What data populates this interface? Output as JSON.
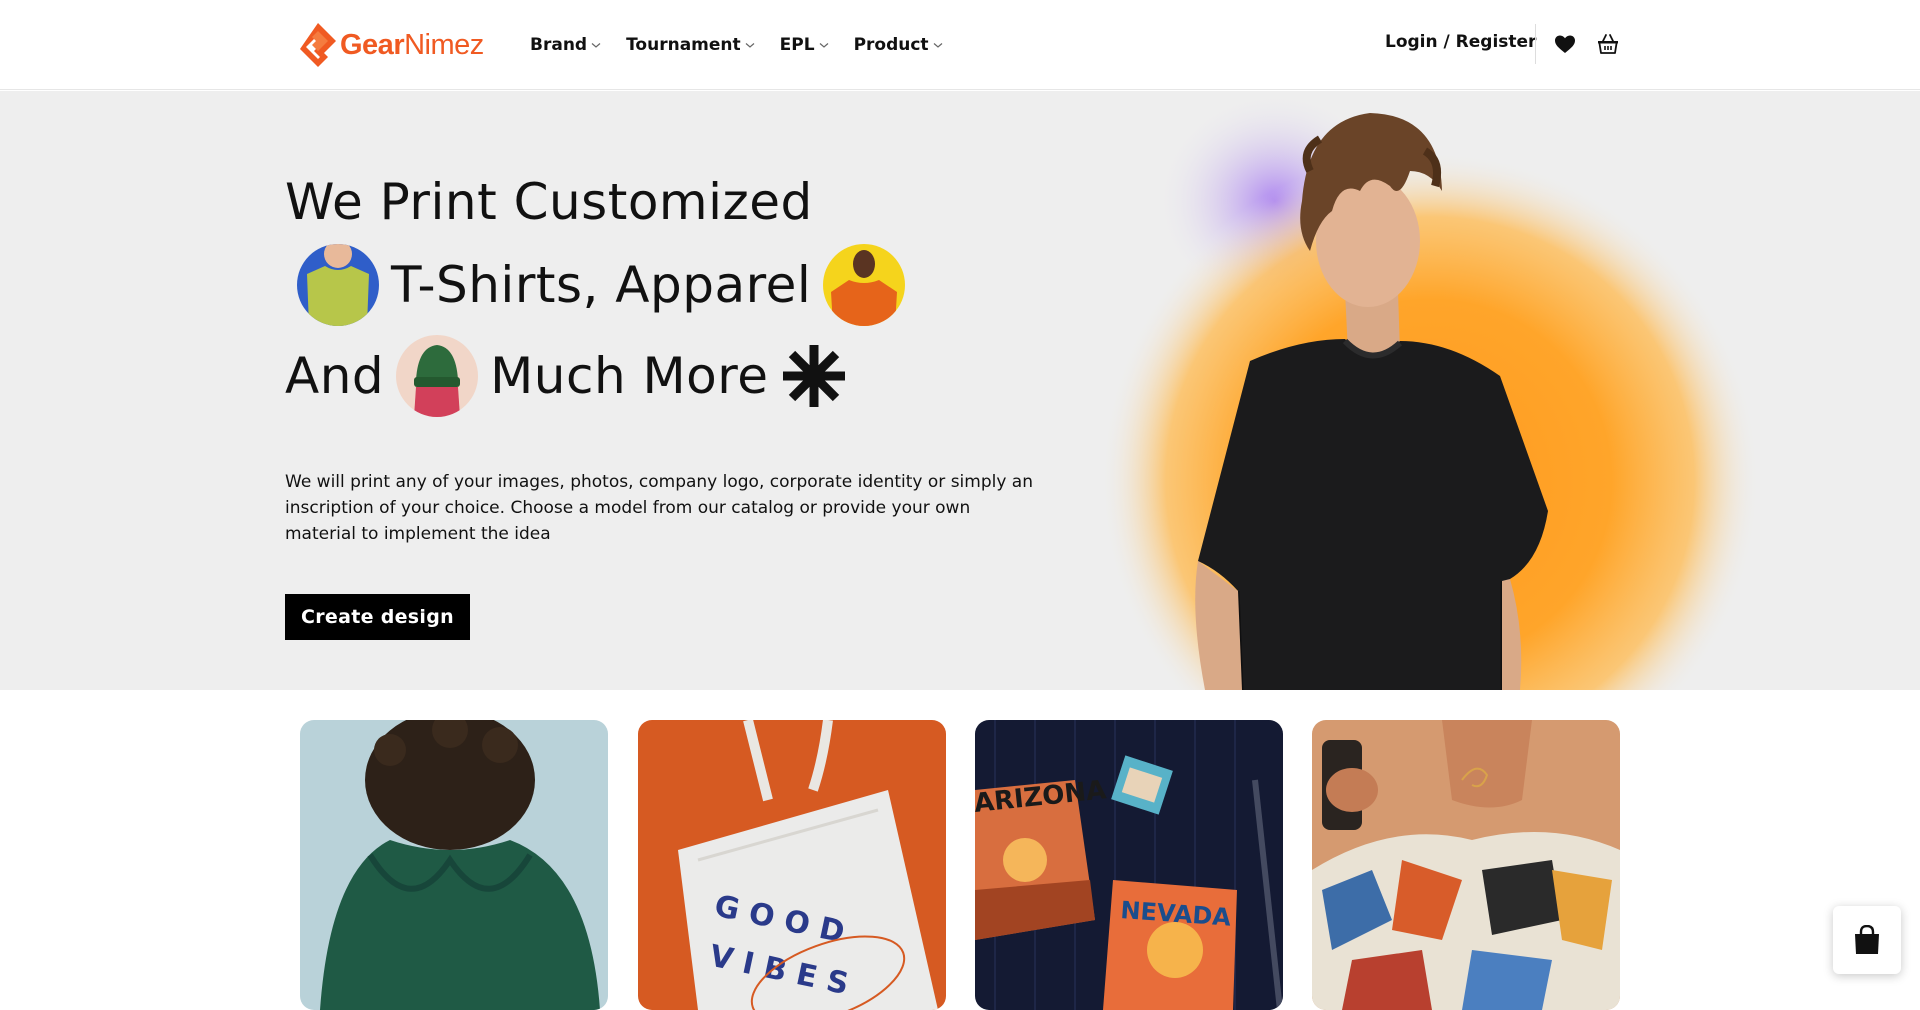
{
  "header": {
    "logo_text_bold": "Gear",
    "logo_text_light": "Nimez",
    "nav": [
      {
        "label": "Brand",
        "icon": "chevron-down-icon"
      },
      {
        "label": "Tournament",
        "icon": "chevron-down-icon"
      },
      {
        "label": "EPL",
        "icon": "chevron-down-icon"
      },
      {
        "label": "Product",
        "icon": "chevron-down-icon"
      }
    ],
    "login_label": "Login / Register",
    "wishlist_icon": "heart-icon",
    "cart_icon": "basket-icon"
  },
  "hero": {
    "line1": "We Print Customized",
    "line2": "T-Shirts, Apparel",
    "line3_a": "And",
    "line3_b": "Much More",
    "description": "We will print any of your images, photos, company logo, corporate identity or simply an inscription of your choice. Choose a model from our catalog or provide your own material to implement the idea",
    "cta_label": "Create design"
  },
  "floating_cart_icon": "shopping-bag-icon",
  "colors": {
    "brand": "#f05a22",
    "hero_bg": "#eeeeee",
    "cta_bg": "#000000",
    "glow_orange": "#ff9a1f",
    "glow_purple": "#a77cf0"
  }
}
